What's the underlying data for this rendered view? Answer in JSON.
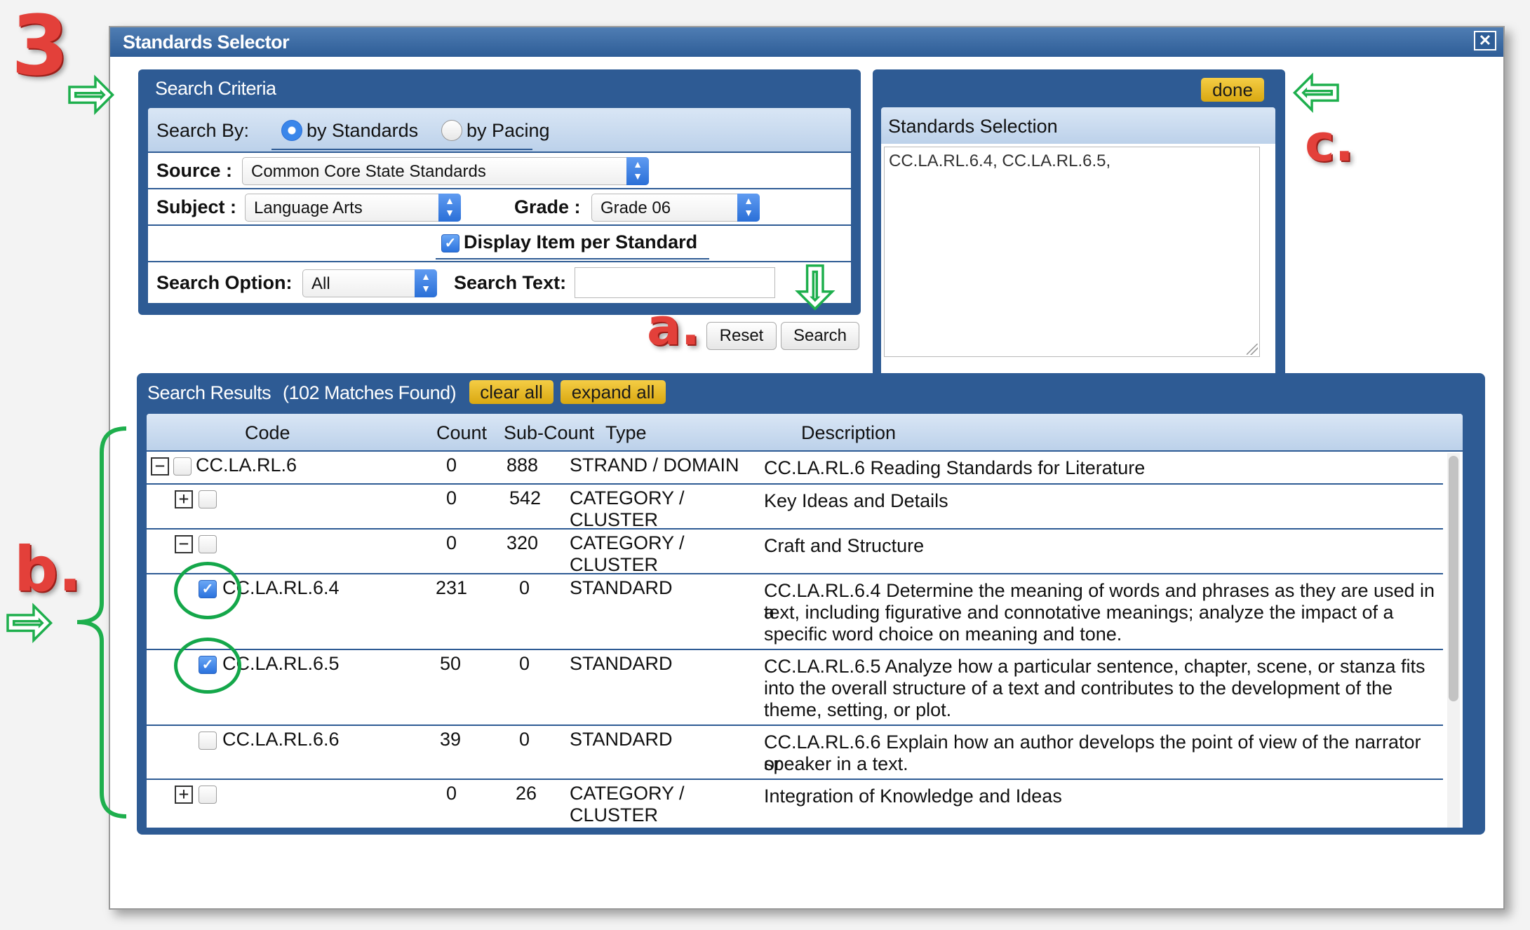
{
  "annotations": {
    "step_number": "3",
    "label_a": "a.",
    "label_b": "b.",
    "label_c": "c."
  },
  "window": {
    "title": "Standards Selector",
    "close_glyph": "✕"
  },
  "search_criteria": {
    "title": "Search Criteria",
    "search_by_label": "Search By:",
    "by_standards": "by Standards",
    "by_pacing": "by Pacing",
    "search_by_selected": "by Standards",
    "source_label": "Source :",
    "source_value": "Common Core State Standards",
    "subject_label": "Subject :",
    "subject_value": "Language Arts",
    "grade_label": "Grade :",
    "grade_value": "Grade 06",
    "display_item_label": "Display Item per Standard",
    "display_item_checked": true,
    "search_option_label": "Search Option:",
    "search_option_value": "All",
    "search_text_label": "Search Text:",
    "search_text_value": ""
  },
  "actions": {
    "reset": "Reset",
    "search": "Search"
  },
  "standards_selection": {
    "done": "done",
    "title": "Standards Selection",
    "value": "CC.LA.RL.6.4, CC.LA.RL.6.5,"
  },
  "results": {
    "title": "Search Results",
    "matches": "(102 Matches Found)",
    "clear_all": "clear all",
    "expand_all": "expand all",
    "columns": {
      "code": "Code",
      "count": "Count",
      "subcount": "Sub-Count",
      "type": "Type",
      "description": "Description"
    },
    "rows": [
      {
        "toggle": "minus",
        "code": "CC.LA.RL.6",
        "count": "0",
        "subcount": "888",
        "type1": "STRAND / DOMAIN",
        "type2": "",
        "desc": [
          "CC.LA.RL.6 Reading Standards for Literature"
        ],
        "checked": false
      },
      {
        "toggle": "plus",
        "code": "",
        "count": "0",
        "subcount": "542",
        "type1": "CATEGORY /",
        "type2": "CLUSTER",
        "desc": [
          "Key Ideas and Details"
        ],
        "checked": false
      },
      {
        "toggle": "minus",
        "code": "",
        "count": "0",
        "subcount": "320",
        "type1": "CATEGORY /",
        "type2": "CLUSTER",
        "desc": [
          "Craft and Structure"
        ],
        "checked": false
      },
      {
        "toggle": "",
        "code": "CC.LA.RL.6.4",
        "count": "231",
        "subcount": "0",
        "type1": "STANDARD",
        "type2": "",
        "desc": [
          "CC.LA.RL.6.4 Determine the meaning of words and phrases as they are used in a",
          "text, including figurative and connotative meanings; analyze the impact of a",
          "specific word choice on meaning and tone."
        ],
        "checked": true
      },
      {
        "toggle": "",
        "code": "CC.LA.RL.6.5",
        "count": "50",
        "subcount": "0",
        "type1": "STANDARD",
        "type2": "",
        "desc": [
          "CC.LA.RL.6.5 Analyze how a particular sentence, chapter, scene, or stanza fits",
          "into the overall structure of a text and contributes to the development of the",
          "theme, setting, or plot."
        ],
        "checked": true
      },
      {
        "toggle": "",
        "code": "CC.LA.RL.6.6",
        "count": "39",
        "subcount": "0",
        "type1": "STANDARD",
        "type2": "",
        "desc": [
          "CC.LA.RL.6.6 Explain how an author develops the point of view of the narrator or",
          "speaker in a text."
        ],
        "checked": false
      },
      {
        "toggle": "plus",
        "code": "",
        "count": "0",
        "subcount": "26",
        "type1": "CATEGORY /",
        "type2": "CLUSTER",
        "desc": [
          "Integration of Knowledge and Ideas"
        ],
        "checked": false
      }
    ]
  },
  "colors": {
    "panel_blue": "#2e5b94",
    "annotation_red": "#e3403a",
    "annotation_green": "#1eaf4d",
    "gold": "#e8bb2a"
  }
}
